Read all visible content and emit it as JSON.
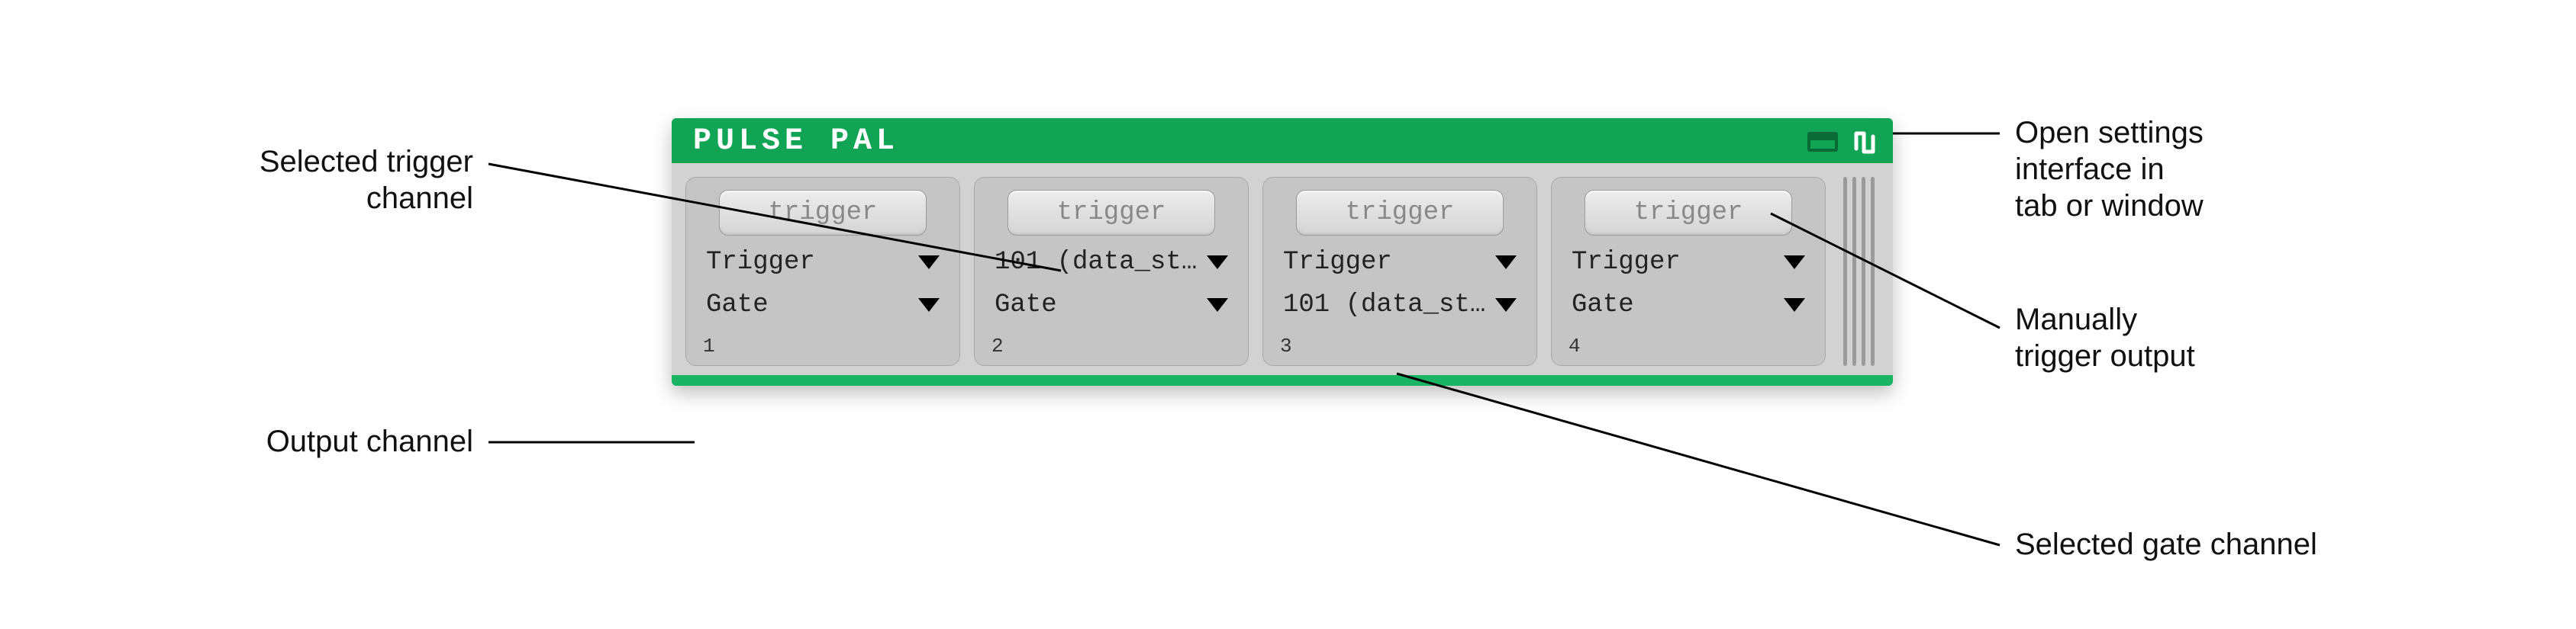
{
  "colors": {
    "accent": "#10a454",
    "accent_light": "#1ab564",
    "panel": "#d2d2d2",
    "card": "#c5c5c5"
  },
  "title": "PULSE PAL",
  "icons": {
    "settings_tab": "window-icon",
    "settings_popout": "pulse-icon"
  },
  "channels": [
    {
      "number": "1",
      "trigger_button": "trigger",
      "trigger_selected": "Trigger",
      "gate_selected": "Gate"
    },
    {
      "number": "2",
      "trigger_button": "trigger",
      "trigger_selected": "101 (data_str...",
      "gate_selected": "Gate"
    },
    {
      "number": "3",
      "trigger_button": "trigger",
      "trigger_selected": "Trigger",
      "gate_selected": "101 (data_str..."
    },
    {
      "number": "4",
      "trigger_button": "trigger",
      "trigger_selected": "Trigger",
      "gate_selected": "Gate"
    }
  ],
  "annotations": {
    "selected_trigger_channel": "Selected trigger\nchannel",
    "output_channel": "Output channel",
    "open_settings": "Open settings\ninterface in\ntab or window",
    "manual_trigger": "Manually\ntrigger output",
    "selected_gate_channel": "Selected gate channel"
  }
}
